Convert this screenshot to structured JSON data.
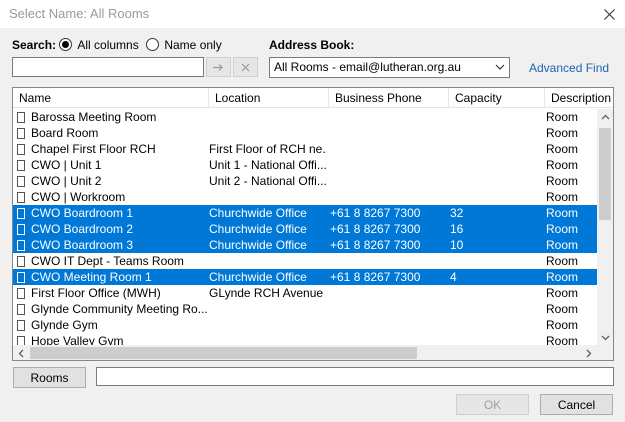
{
  "window": {
    "title": "Select Name: All Rooms",
    "close_icon": "close-icon"
  },
  "search": {
    "label": "Search:",
    "opt_all": "All columns",
    "opt_name": "Name only",
    "selected": "All columns",
    "value": "",
    "go_icon": "arrow-right-icon",
    "clear_icon": "x-icon"
  },
  "address_book": {
    "label": "Address Book:",
    "value": "All Rooms - email@lutheran.org.au",
    "advanced_find": "Advanced Find"
  },
  "table": {
    "headers": [
      "Name",
      "Location",
      "Business Phone",
      "Capacity",
      "Description"
    ],
    "rows": [
      {
        "name": "Barossa Meeting Room",
        "location": "",
        "phone": "",
        "capacity": "",
        "desc": "Room",
        "selected": false
      },
      {
        "name": "Board Room",
        "location": "",
        "phone": "",
        "capacity": "",
        "desc": "Room",
        "selected": false
      },
      {
        "name": "Chapel First Floor RCH",
        "location": "First Floor of RCH ne...",
        "phone": "",
        "capacity": "",
        "desc": "Room",
        "selected": false
      },
      {
        "name": "CWO | Unit 1",
        "location": "Unit 1 - National Offi...",
        "phone": "",
        "capacity": "",
        "desc": "Room",
        "selected": false
      },
      {
        "name": "CWO | Unit 2",
        "location": "Unit 2 - National Offi...",
        "phone": "",
        "capacity": "",
        "desc": "Room",
        "selected": false
      },
      {
        "name": "CWO | Workroom",
        "location": "",
        "phone": "",
        "capacity": "",
        "desc": "Room",
        "selected": false
      },
      {
        "name": "CWO Boardroom 1",
        "location": "Churchwide Office",
        "phone": "+61 8 8267 7300",
        "capacity": "32",
        "desc": "Room",
        "selected": true
      },
      {
        "name": "CWO Boardroom 2",
        "location": "Churchwide Office",
        "phone": "+61 8 8267 7300",
        "capacity": "16",
        "desc": "Room",
        "selected": true
      },
      {
        "name": "CWO Boardroom 3",
        "location": "Churchwide Office",
        "phone": "+61 8 8267 7300",
        "capacity": "10",
        "desc": "Room",
        "selected": true
      },
      {
        "name": "CWO IT Dept - Teams Room",
        "location": "",
        "phone": "",
        "capacity": "",
        "desc": "Room",
        "selected": false
      },
      {
        "name": "CWO Meeting Room 1",
        "location": "Churchwide Office",
        "phone": "+61 8 8267 7300",
        "capacity": "4",
        "desc": "Room",
        "selected": true
      },
      {
        "name": "First Floor Office (MWH)",
        "location": "GLynde RCH Avenue ...",
        "phone": "",
        "capacity": "",
        "desc": "Room",
        "selected": false
      },
      {
        "name": "Glynde Community Meeting Ro...",
        "location": "",
        "phone": "",
        "capacity": "",
        "desc": "Room",
        "selected": false
      },
      {
        "name": "Glynde Gym",
        "location": "",
        "phone": "",
        "capacity": "",
        "desc": "Room",
        "selected": false
      },
      {
        "name": "Hope Valley Gym",
        "location": "",
        "phone": "",
        "capacity": "",
        "desc": "Room",
        "selected": false
      }
    ]
  },
  "footer": {
    "rooms_button": "Rooms",
    "rooms_value": "",
    "ok": "OK",
    "cancel": "Cancel"
  },
  "colors": {
    "selection": "#0078d7",
    "link": "#1e64b4"
  }
}
